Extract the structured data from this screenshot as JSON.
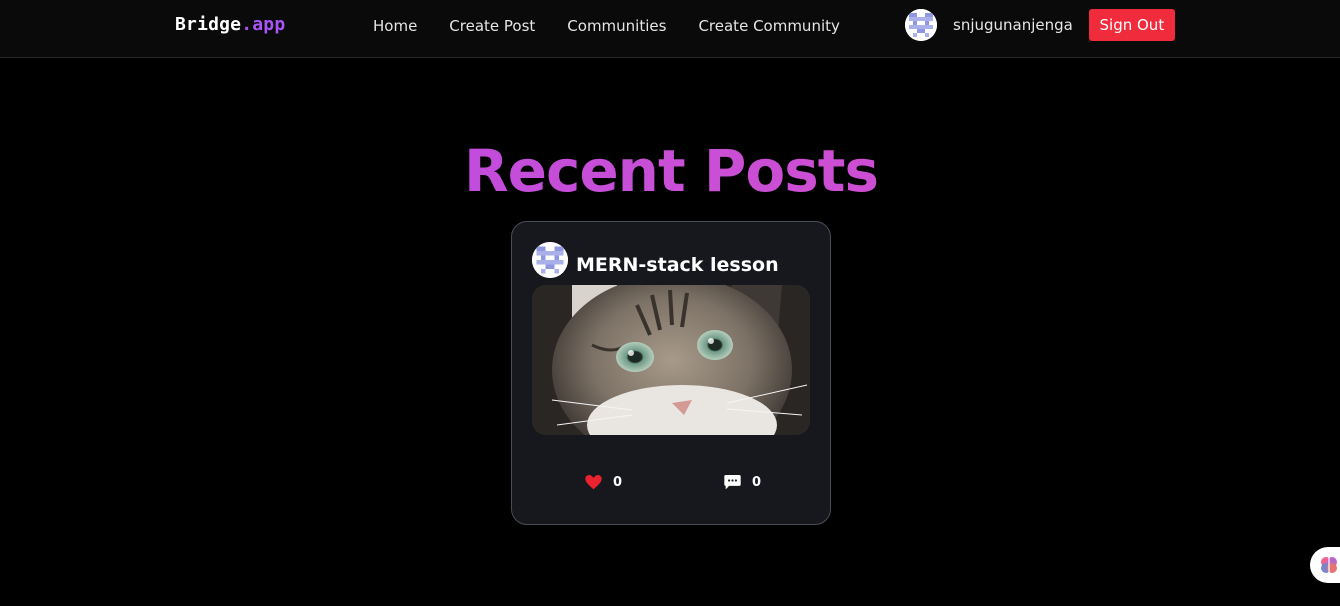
{
  "navbar": {
    "brand_main": "Bridge",
    "brand_suffix": ".app",
    "links": {
      "home": "Home",
      "create_post": "Create Post",
      "communities": "Communities",
      "create_community": "Create Community"
    },
    "user": {
      "username": "snjugunanjenga",
      "avatar_icon": "pixel-avatar-icon"
    },
    "signout_label": "Sign Out"
  },
  "page": {
    "title": "Recent Posts"
  },
  "posts": [
    {
      "title": "MERN-stack lesson",
      "image_icon": "cat-photo",
      "likes": "0",
      "comments": "0"
    }
  ],
  "colors": {
    "accent_purple": "#a855f7",
    "title_gradient_start": "#b545e8",
    "title_gradient_end": "#d94bc9",
    "signout_red": "#ef2b3c",
    "like_red": "#e8232f",
    "background": "#000000",
    "card_background": "#16181d"
  }
}
